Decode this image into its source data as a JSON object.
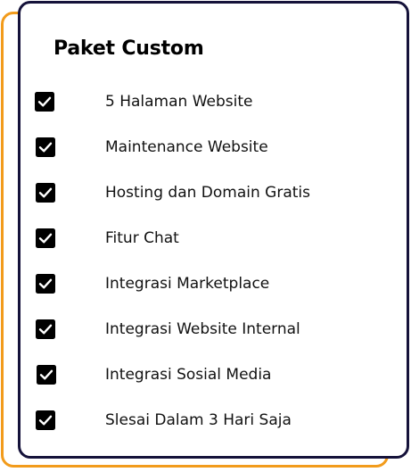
{
  "card": {
    "title": "Paket Custom"
  },
  "features": [
    {
      "label": "5 Halaman Website",
      "icon": "checkbox-checked-icon"
    },
    {
      "label": "Maintenance Website",
      "icon": "checkbox-checked-icon"
    },
    {
      "label": "Hosting dan Domain Gratis",
      "icon": "checkbox-checked-icon"
    },
    {
      "label": "Fitur Chat",
      "icon": "checkbox-checked-icon"
    },
    {
      "label": "Integrasi Marketplace",
      "icon": "checkbox-checked-icon"
    },
    {
      "label": "Integrasi Website Internal",
      "icon": "checkbox-checked-icon"
    },
    {
      "label": "Integrasi Sosial Media",
      "icon": "checkbox-checked-icon"
    },
    {
      "label": "Slesai Dalam 3 Hari Saja",
      "icon": "checkbox-checked-icon"
    }
  ],
  "colors": {
    "accent_border": "#f29b1b",
    "card_border": "#15123a",
    "checkbox": "#000000"
  }
}
